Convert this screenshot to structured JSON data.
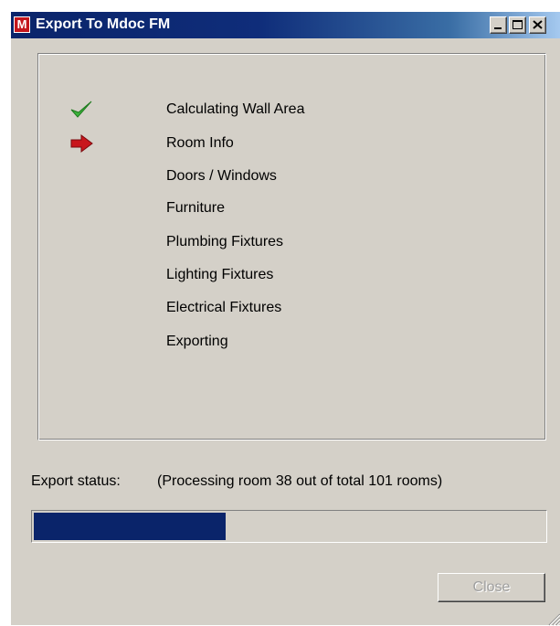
{
  "window": {
    "title": "Export To Mdoc FM",
    "app_icon_letter": "M",
    "app_icon_color": "#c4161c",
    "title_bar_color": "#0a246a"
  },
  "steps": [
    {
      "label": "Calculating Wall Area",
      "state": "done",
      "icon": "check-icon"
    },
    {
      "label": "Room Info",
      "state": "current",
      "icon": "arrow-right-icon"
    },
    {
      "label": "Doors / Windows",
      "state": "pending",
      "icon": ""
    },
    {
      "label": "Furniture",
      "state": "pending",
      "icon": ""
    },
    {
      "label": "Plumbing Fixtures",
      "state": "pending",
      "icon": ""
    },
    {
      "label": "Lighting Fixtures",
      "state": "pending",
      "icon": ""
    },
    {
      "label": "Electrical Fixtures",
      "state": "pending",
      "icon": ""
    },
    {
      "label": "Exporting",
      "state": "pending",
      "icon": ""
    }
  ],
  "status": {
    "label": "Export status:",
    "text": "(Processing room 38 out of total 101 rooms)",
    "progress_fraction": 0.376
  },
  "buttons": {
    "close_label": "Close",
    "close_enabled": false
  },
  "colors": {
    "check": "#3cb43c",
    "arrow": "#c8161c",
    "progress": "#0a246a"
  }
}
